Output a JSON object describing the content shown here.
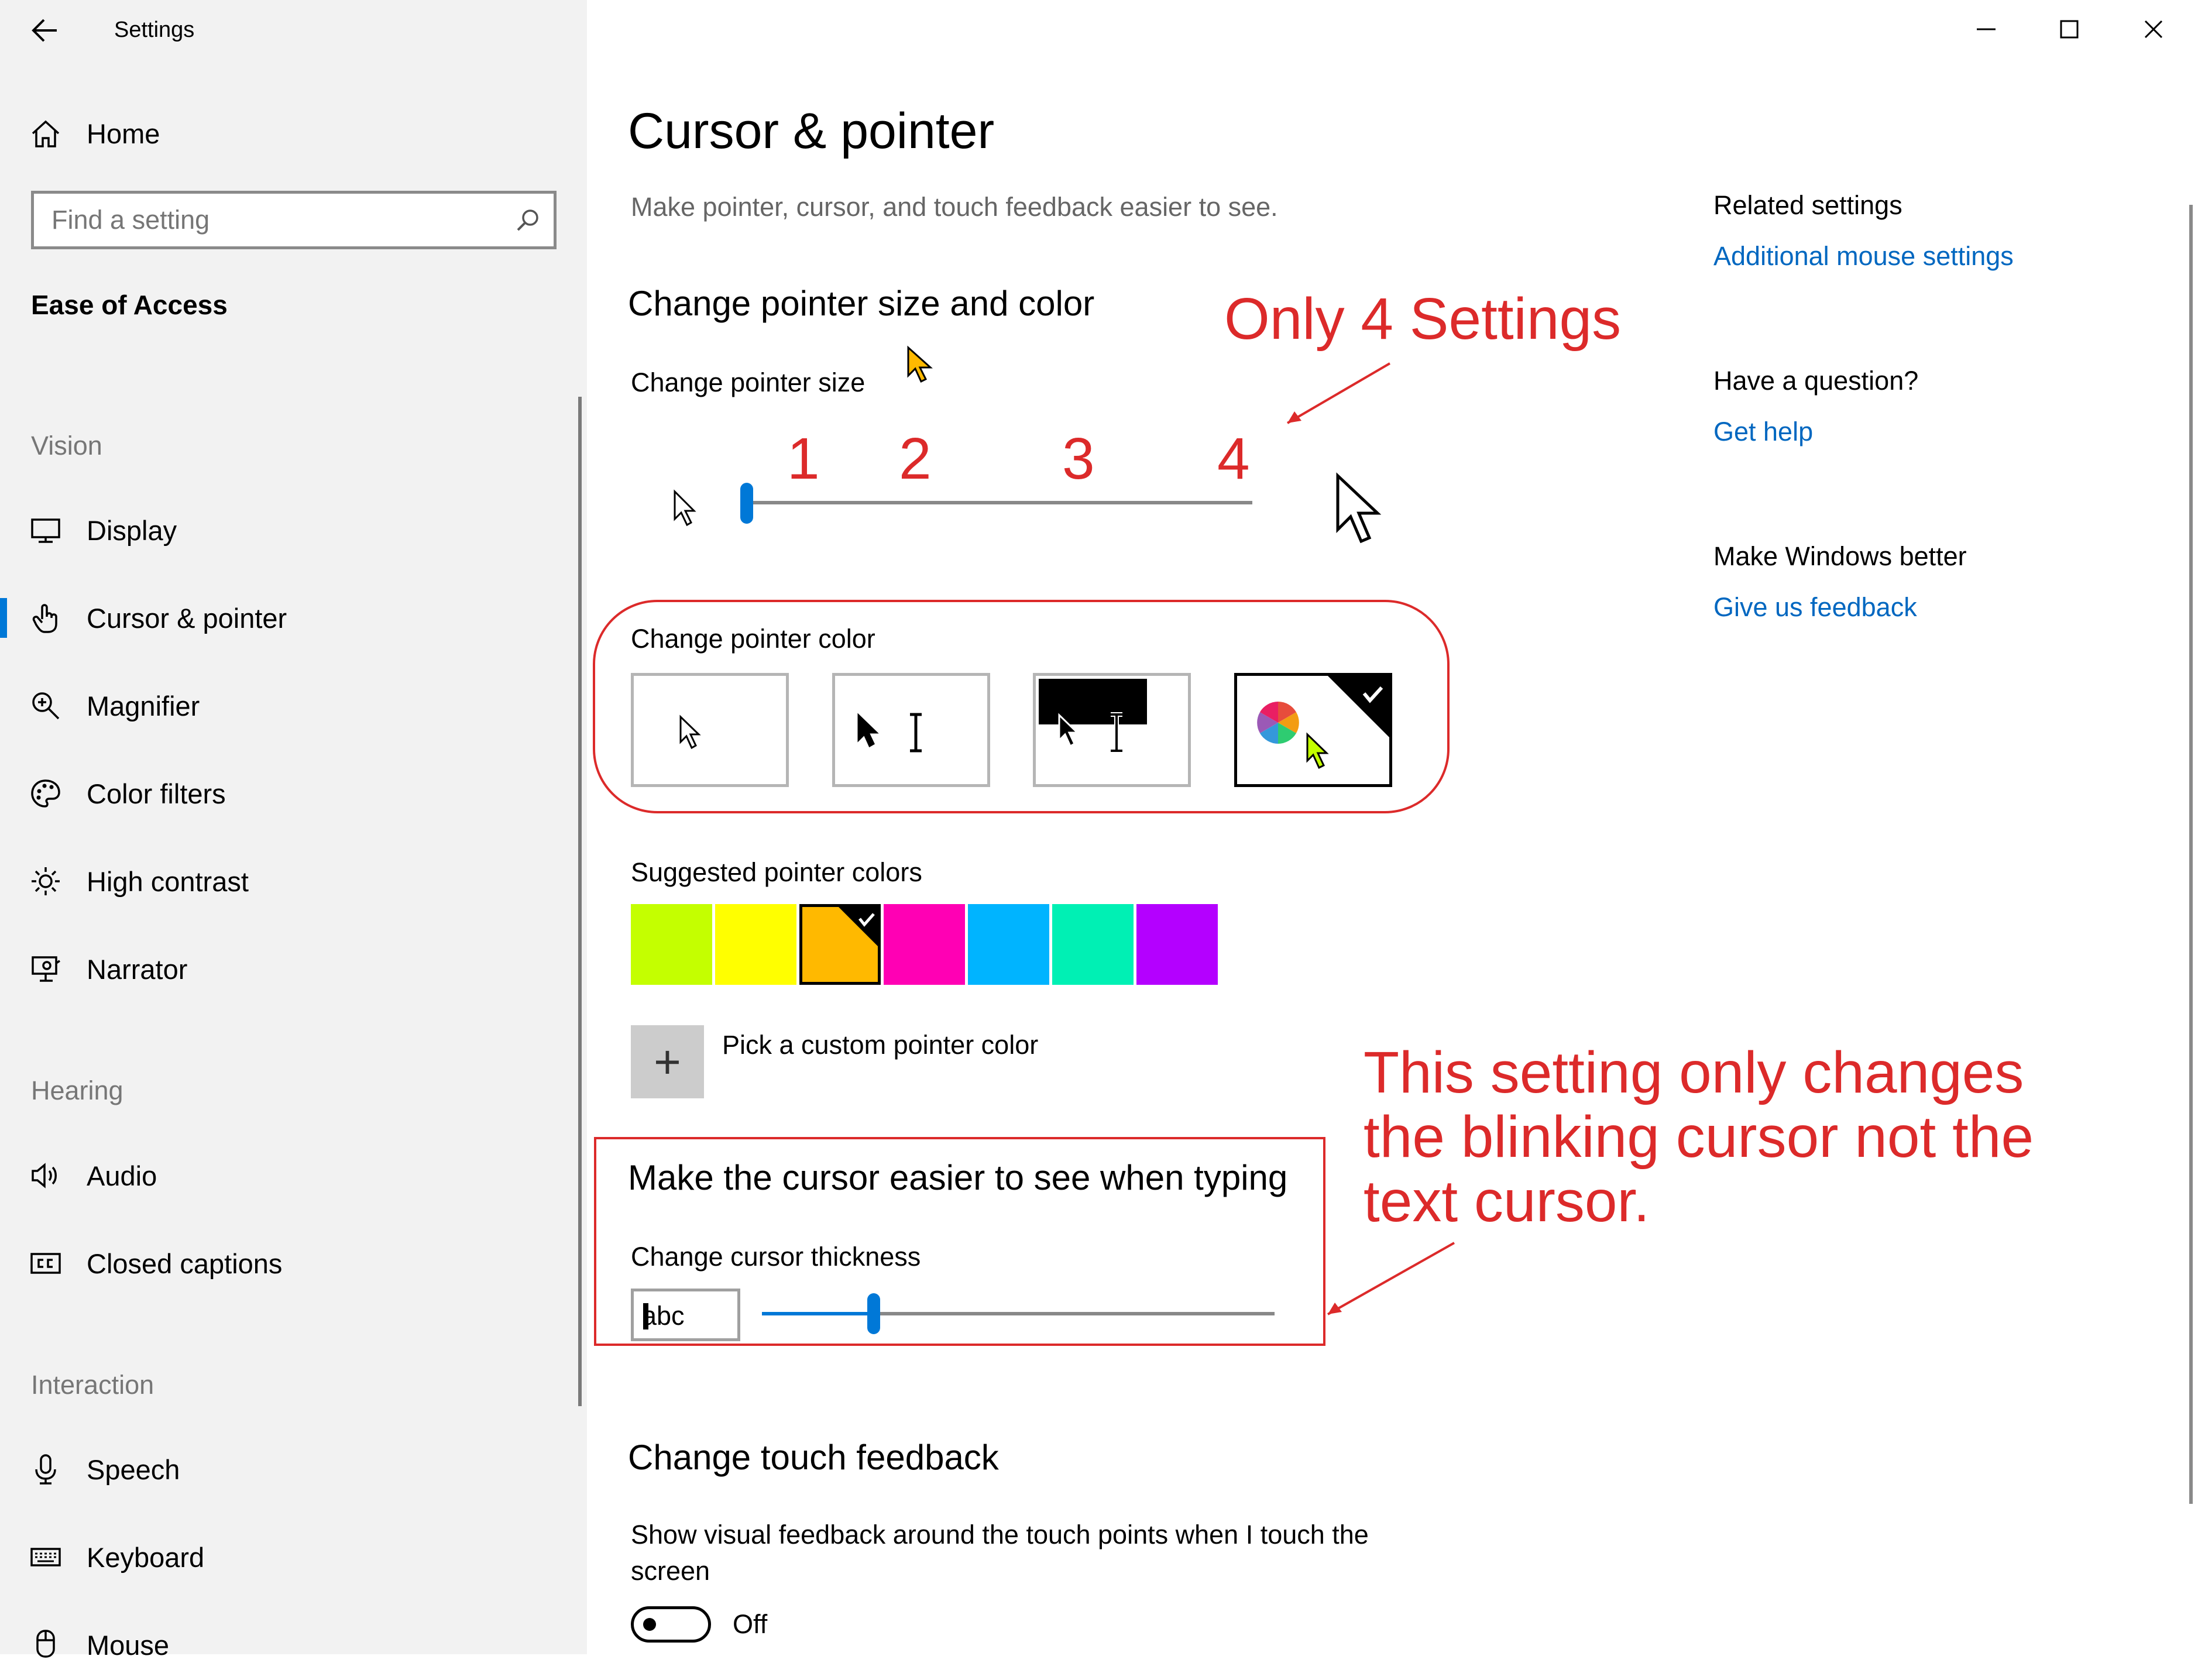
{
  "window": {
    "title": "Settings"
  },
  "sidebar": {
    "home_label": "Home",
    "search_placeholder": "Find a setting",
    "category": "Ease of Access",
    "sections": [
      {
        "header": "Vision",
        "items": [
          {
            "label": "Display",
            "icon": "monitor-icon"
          },
          {
            "label": "Cursor & pointer",
            "icon": "hand-pointer-icon",
            "selected": true
          },
          {
            "label": "Magnifier",
            "icon": "magnifier-icon"
          },
          {
            "label": "Color filters",
            "icon": "palette-icon"
          },
          {
            "label": "High contrast",
            "icon": "sun-icon"
          },
          {
            "label": "Narrator",
            "icon": "narrator-icon"
          }
        ]
      },
      {
        "header": "Hearing",
        "items": [
          {
            "label": "Audio",
            "icon": "speaker-icon"
          },
          {
            "label": "Closed captions",
            "icon": "cc-icon"
          }
        ]
      },
      {
        "header": "Interaction",
        "items": [
          {
            "label": "Speech",
            "icon": "microphone-icon"
          },
          {
            "label": "Keyboard",
            "icon": "keyboard-icon"
          },
          {
            "label": "Mouse",
            "icon": "mouse-icon"
          }
        ]
      }
    ],
    "accent_color": "#0078d7"
  },
  "main": {
    "title": "Cursor & pointer",
    "subtitle": "Make pointer, cursor, and touch feedback easier to see.",
    "pointer_section": {
      "title": "Change pointer size and color",
      "size_label": "Change pointer size",
      "size_value": 1,
      "size_range": [
        1,
        4
      ],
      "color_label": "Change pointer color",
      "color_options": [
        {
          "name": "white",
          "selected": false
        },
        {
          "name": "black",
          "selected": false
        },
        {
          "name": "inverted",
          "selected": false
        },
        {
          "name": "custom",
          "selected": true
        }
      ],
      "suggested_label": "Suggested pointer colors",
      "suggested_colors": [
        {
          "hex": "#c4ff00",
          "selected": false
        },
        {
          "hex": "#ffff00",
          "selected": false
        },
        {
          "hex": "#ffb900",
          "selected": true
        },
        {
          "hex": "#ff00b4",
          "selected": false
        },
        {
          "hex": "#00b4ff",
          "selected": false
        },
        {
          "hex": "#00f0b4",
          "selected": false
        },
        {
          "hex": "#b400ff",
          "selected": false
        }
      ],
      "custom_color_label": "Pick a custom pointer color",
      "custom_color_plus": "+"
    },
    "cursor_section": {
      "title": "Make the cursor easier to see when typing",
      "thickness_label": "Change cursor thickness",
      "preview_text": "abc",
      "thickness_value": 5,
      "thickness_range": [
        1,
        20
      ]
    },
    "touch_section": {
      "title": "Change touch feedback",
      "description": "Show visual feedback around the touch points when I touch the screen",
      "toggle_state": "Off"
    }
  },
  "related": {
    "related_title": "Related settings",
    "additional_mouse_link": "Additional mouse settings",
    "question_title": "Have a question?",
    "get_help_link": "Get help",
    "better_title": "Make Windows better",
    "feedback_link": "Give us feedback"
  },
  "annotations": {
    "only_four": "Only 4 Settings",
    "tick_labels": [
      "1",
      "2",
      "3",
      "4"
    ],
    "cursor_note_lines": [
      "This setting only changes",
      "the blinking cursor not the",
      "text cursor."
    ],
    "color": "#dc2a2a"
  }
}
